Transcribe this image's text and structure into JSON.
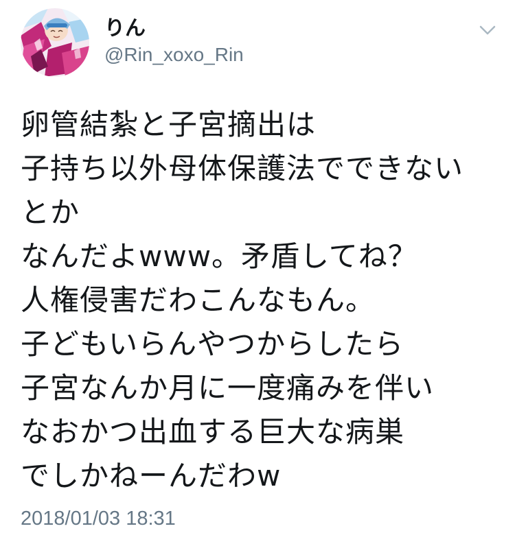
{
  "author": {
    "display_name": "りん",
    "handle": "@Rin_xoxo_Rin",
    "avatar_icon": "anime-character-avatar"
  },
  "menu": {
    "icon": "chevron-down-icon"
  },
  "tweet": {
    "lines": [
      "卵管結紮と子宮摘出は",
      "子持ち以外母体保護法でできない",
      "とか",
      "なんだよwww。矛盾してね？",
      "人権侵害だわこんなもん。",
      "子どもいらんやつからしたら",
      "子宮なんか月に一度痛みを伴い",
      "なおかつ出血する巨大な病巣",
      "でしかねーんだわw"
    ]
  },
  "timestamp": "2018/01/03 18:31",
  "colors": {
    "text": "#14171a",
    "secondary": "#657786",
    "chevron": "#aab8c2"
  }
}
